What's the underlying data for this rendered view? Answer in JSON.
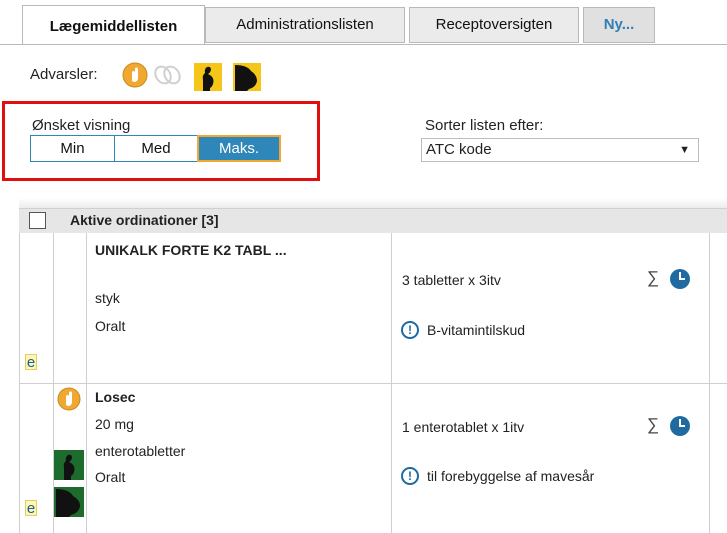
{
  "tabs": [
    {
      "label": "Lægemiddellisten",
      "active": true
    },
    {
      "label": "Administrationslisten",
      "active": false
    },
    {
      "label": "Receptoversigten",
      "active": false
    },
    {
      "label": "Ny...",
      "active": false
    }
  ],
  "warnings": {
    "label": "Advarsler:"
  },
  "view": {
    "label": "Ønsket visning",
    "options": [
      "Min",
      "Med",
      "Maks."
    ],
    "selected": "Maks."
  },
  "sort": {
    "label": "Sorter listen efter:",
    "value": "ATC kode"
  },
  "section": {
    "title": "Aktive ordinationer [3]"
  },
  "rows": [
    {
      "name": "UNIKALK FORTE K2 TABL ...",
      "unit": "styk",
      "route": "Oralt",
      "dosage": "3 tabletter x 3itv",
      "note": "B-vitamintilskud",
      "e_mark": "e"
    },
    {
      "name": "Losec",
      "strength": "20 mg",
      "form": "enterotabletter",
      "route": "Oralt",
      "dosage": "1 enterotablet x 1itv",
      "note": "til forebyggelse af mavesår",
      "e_mark": "e"
    }
  ],
  "icons": {
    "sigma": "∑",
    "info": "!"
  },
  "colors": {
    "accent_blue": "#2f86b8",
    "highlight_red": "#e01010",
    "warning_orange": "#f0a830",
    "pregnancy_yellow": "#f5c518"
  }
}
